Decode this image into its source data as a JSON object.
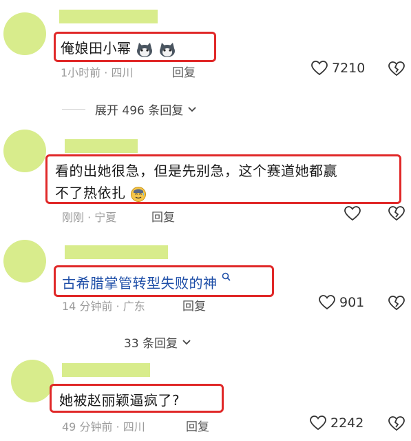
{
  "colors": {
    "avatar": "#d8ec8c",
    "namebar": "#d8ec8c",
    "highlight": "#e02828",
    "link": "#1f4fa8"
  },
  "comments": [
    {
      "text": "俺娘田小幂",
      "emoji": [
        "cat-face-icon",
        "cat-face-icon"
      ],
      "meta": "1小时前 · 四川",
      "reply": "回复",
      "likes": "7210",
      "expand": "展开 496 条回复"
    },
    {
      "text_line1": "看的出她很急，但是先别急，这个赛道她都赢",
      "text_line2": "不了热依扎",
      "emoji": [
        "sweat-smile-icon"
      ],
      "meta": "刚刚 · 宁夏",
      "reply": "回复",
      "likes": ""
    },
    {
      "text": "古希腊掌管转型失败的神",
      "search_icon": "search-icon",
      "meta": "14 分钟前 · 广东",
      "reply": "回复",
      "likes": "901",
      "expand": "33 条回复"
    },
    {
      "text": "她被赵丽颖逼疯了?",
      "meta": "49 分钟前 · 四川",
      "reply": "回复",
      "likes": "2242"
    }
  ]
}
